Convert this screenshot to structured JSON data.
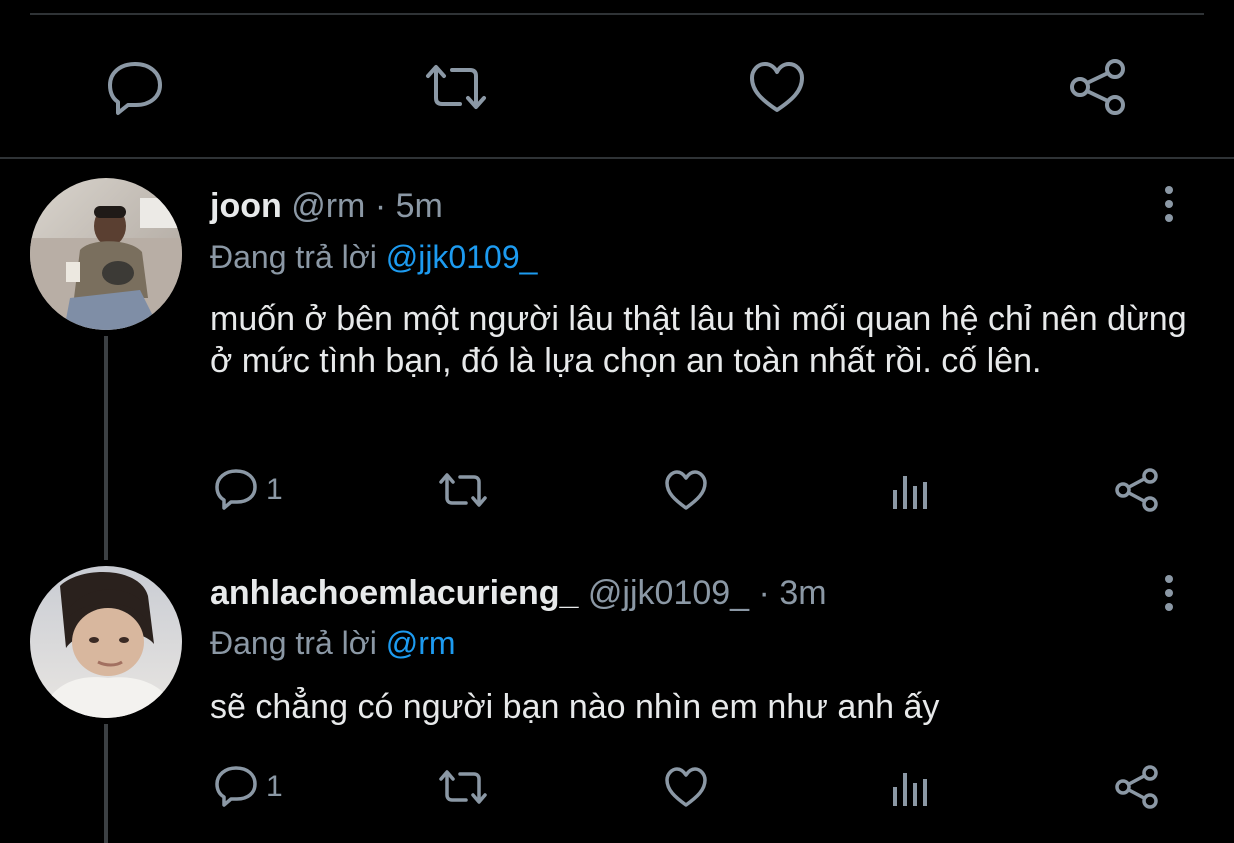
{
  "top_actions": {
    "reply_icon": "speech-bubble-icon",
    "retweet_icon": "retweet-icon",
    "like_icon": "heart-icon",
    "share_icon": "share-icon"
  },
  "tweets": [
    {
      "display_name": "joon",
      "handle": "@rm",
      "separator": "·",
      "time": "5m",
      "reply_prefix": "Đang trả lời",
      "reply_to": "@jjk0109_",
      "text": "muốn ở bên một người lâu thật lâu thì mối quan hệ chỉ nên dừng ở mức tình bạn, đó là lựa chọn an toàn nhất rồi. cố lên.",
      "reply_count": "1"
    },
    {
      "display_name": "anhlachoemlacurieng_",
      "handle": "@jjk0109_",
      "separator": "·",
      "time": "3m",
      "reply_prefix": "Đang trả lời",
      "reply_to": "@rm",
      "text": "sẽ chẳng có người bạn nào nhìn em như anh ấy",
      "reply_count": "1"
    }
  ],
  "colors": {
    "background": "#000000",
    "text": "#e7e9ea",
    "secondary": "#8b98a5",
    "accent": "#1d9bf0",
    "divider": "#2f3336"
  }
}
